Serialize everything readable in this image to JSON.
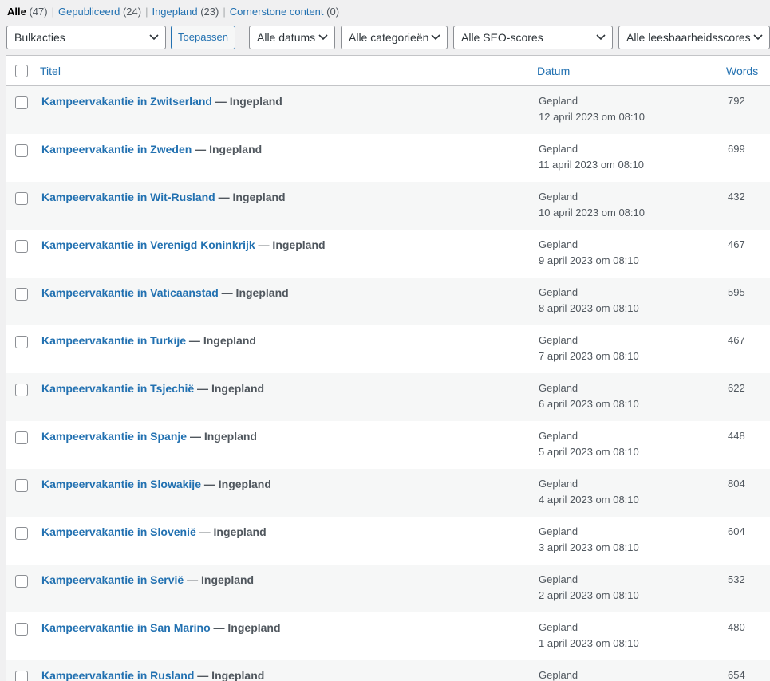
{
  "filters": [
    {
      "label": "Alle",
      "count": "(47)",
      "current": true
    },
    {
      "label": "Gepubliceerd",
      "count": "(24)",
      "current": false
    },
    {
      "label": "Ingepland",
      "count": "(23)",
      "current": false
    },
    {
      "label": "Cornerstone content",
      "count": "(0)",
      "current": false
    }
  ],
  "toolbar": {
    "bulk_actions": "Bulkacties",
    "apply": "Toepassen",
    "dates": "Alle datums",
    "categories": "Alle categorieën",
    "seo_scores": "Alle SEO-scores",
    "readability": "Alle leesbaarheidsscores"
  },
  "table": {
    "headers": {
      "title": "Titel",
      "date": "Datum",
      "words": "Words"
    },
    "rows": [
      {
        "title": "Kampeervakantie in Zwitserland",
        "state": " — Ingepland",
        "status": "Gepland",
        "date": "12 april 2023 om 08:10",
        "words": "792"
      },
      {
        "title": "Kampeervakantie in Zweden",
        "state": " — Ingepland",
        "status": "Gepland",
        "date": "11 april 2023 om 08:10",
        "words": "699"
      },
      {
        "title": "Kampeervakantie in Wit-Rusland",
        "state": " — Ingepland",
        "status": "Gepland",
        "date": "10 april 2023 om 08:10",
        "words": "432"
      },
      {
        "title": "Kampeervakantie in Verenigd Koninkrijk",
        "state": " — Ingepland",
        "status": "Gepland",
        "date": "9 april 2023 om 08:10",
        "words": "467"
      },
      {
        "title": "Kampeervakantie in Vaticaanstad",
        "state": " — Ingepland",
        "status": "Gepland",
        "date": "8 april 2023 om 08:10",
        "words": "595"
      },
      {
        "title": "Kampeervakantie in Turkije",
        "state": " — Ingepland",
        "status": "Gepland",
        "date": "7 april 2023 om 08:10",
        "words": "467"
      },
      {
        "title": "Kampeervakantie in Tsjechië",
        "state": " — Ingepland",
        "status": "Gepland",
        "date": "6 april 2023 om 08:10",
        "words": "622"
      },
      {
        "title": "Kampeervakantie in Spanje",
        "state": " — Ingepland",
        "status": "Gepland",
        "date": "5 april 2023 om 08:10",
        "words": "448"
      },
      {
        "title": "Kampeervakantie in Slowakije",
        "state": " — Ingepland",
        "status": "Gepland",
        "date": "4 april 2023 om 08:10",
        "words": "804"
      },
      {
        "title": "Kampeervakantie in Slovenië",
        "state": " — Ingepland",
        "status": "Gepland",
        "date": "3 april 2023 om 08:10",
        "words": "604"
      },
      {
        "title": "Kampeervakantie in Servië",
        "state": " — Ingepland",
        "status": "Gepland",
        "date": "2 april 2023 om 08:10",
        "words": "532"
      },
      {
        "title": "Kampeervakantie in San Marino",
        "state": " — Ingepland",
        "status": "Gepland",
        "date": "1 april 2023 om 08:10",
        "words": "480"
      },
      {
        "title": "Kampeervakantie in Rusland",
        "state": " — Ingepland",
        "status": "Gepland",
        "date": "",
        "words": "654"
      }
    ]
  },
  "colors": {
    "link": "#2271b1",
    "text": "#50575e",
    "alt_row": "#f6f7f7"
  }
}
